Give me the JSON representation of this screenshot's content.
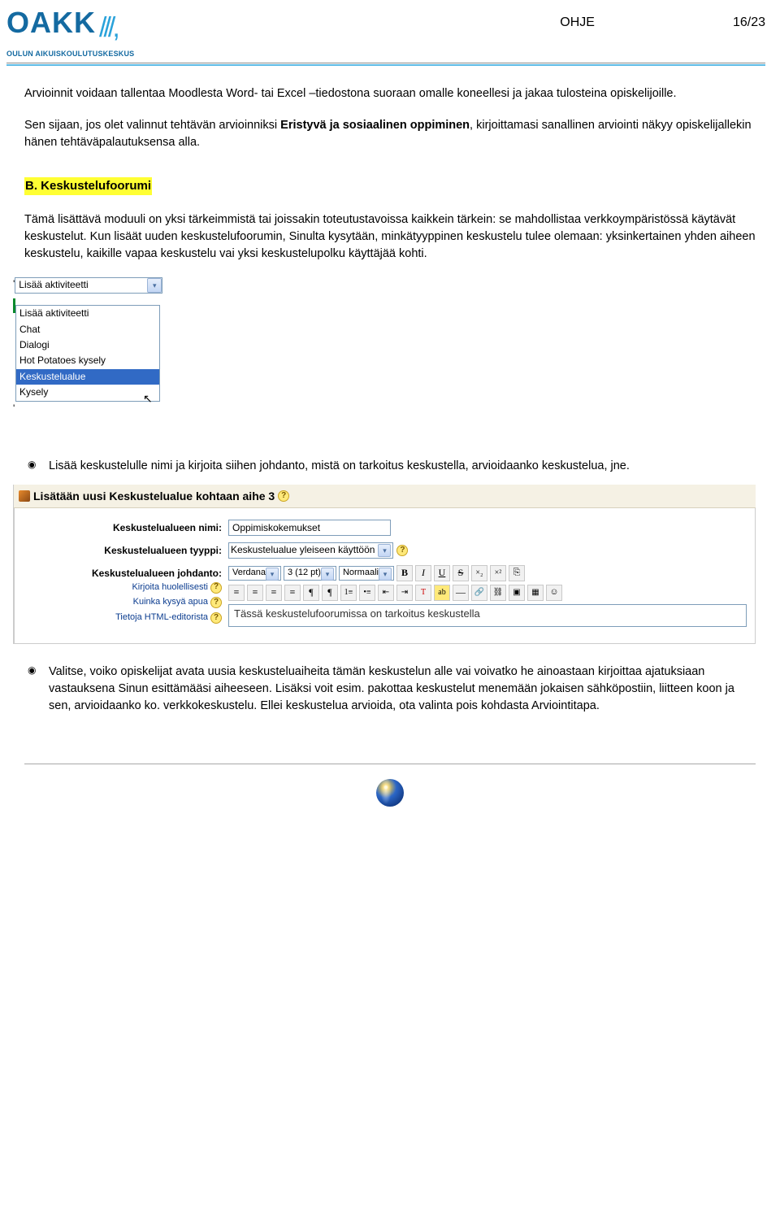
{
  "header": {
    "logo_text": "OAKK",
    "logo_subtitle": "OULUN AIKUISKOULUTUSKESKUS",
    "doc_type": "OHJE",
    "page_num": "16/23"
  },
  "intro_p1": "Arvioinnit voidaan tallentaa Moodlesta Word- tai Excel –tiedostona suoraan omalle koneellesi ja jakaa tulosteina opiskelijoille.",
  "intro_p2a": "Sen sijaan, jos olet valinnut tehtävän arvioinniksi ",
  "intro_p2b": "Eristyvä ja sosiaalinen oppiminen",
  "intro_p2c": ", kirjoittamasi sanallinen arviointi näkyy opiskelijallekin hänen tehtäväpalautuksensa alla.",
  "section_heading": "B. Keskustelufoorumi",
  "section_p1": "Tämä lisättävä moduuli on yksi tärkeimmistä tai joissakin toteutustavoissa kaikkein tärkein: se mahdollistaa verkkoympäristössä käytävät keskustelut. Kun lisäät uuden keskustelufoorumin, Sinulta kysytään, minkätyyppinen keskustelu tulee olemaan: yksinkertainen yhden aiheen keskustelu, kaikille vapaa keskustelu vai yksi keskustelupolku käyttäjää kohti.",
  "dropdown": {
    "closed_label": "Lisää aktiviteetti",
    "options": [
      "Lisää aktiviteetti",
      "Chat",
      "Dialogi",
      "Hot Potatoes kysely",
      "Keskustelualue",
      "Kysely"
    ],
    "selected_index": 4
  },
  "bullet1": "Lisää keskustelulle nimi ja kirjoita siihen johdanto, mistä on tarkoitus keskustella, arvioidaanko keskustelua, jne.",
  "form": {
    "title": "Lisätään uusi Keskustelualue kohtaan aihe 3",
    "rows": {
      "name_label": "Keskustelualueen nimi:",
      "name_value": "Oppimiskokemukset",
      "type_label": "Keskustelualueen tyyppi:",
      "type_value": "Keskustelualue yleiseen käyttöön",
      "intro_label": "Keskustelualueen johdanto:",
      "help1": "Kirjoita huolellisesti",
      "help2": "Kuinka kysyä apua",
      "help3": "Tietoja HTML-editorista"
    },
    "toolbar": {
      "font": "Verdana",
      "size": "3 (12 pt)",
      "style": "Normaali"
    },
    "editor_text": "Tässä keskustelufoorumissa on tarkoitus keskustella"
  },
  "bullet2": "Valitse, voiko opiskelijat avata uusia keskusteluaiheita tämän keskustelun alle vai voivatko he ainoastaan kirjoittaa ajatuksiaan vastauksena Sinun esittämääsi aiheeseen. Lisäksi voit esim. pakottaa keskustelut menemään jokaisen sähköpostiin, liitteen koon ja sen, arvioidaanko ko. verkkokeskustelu. Ellei keskustelua arvioida, ota valinta pois kohdasta Arviointitapa."
}
